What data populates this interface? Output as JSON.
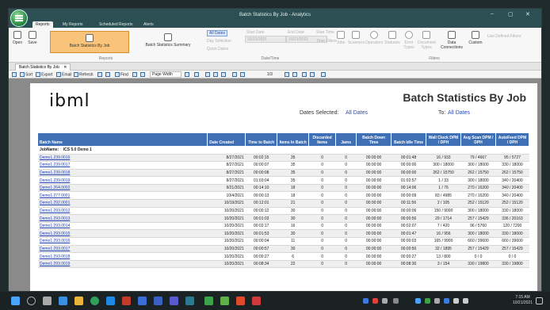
{
  "window": {
    "title": "Batch Statistics By Job - Analytics",
    "min": "–",
    "max": "▢",
    "close": "✕"
  },
  "ribbon_tabs": [
    "Reports",
    "My Reports",
    "Scheduled Reports",
    "Alerts"
  ],
  "ribbon": {
    "open": "Open",
    "save": "Save",
    "batch_stats_by_job": "Batch Statistics By Job",
    "batch_stats_summary": "Batch Statistics Summary",
    "reports_group": "Reports",
    "all_dates": "All Dates",
    "day_selection": "Day Selection",
    "start_date_label": "Start Date",
    "start_date": "10/21/2021",
    "end_date_label": "End Date",
    "end_date": "10/21/2021",
    "quick_dates": "Quick Dates",
    "date_time_group": "Date/Time",
    "start_time": "Start Time",
    "time_filters": "Time Filters",
    "jobs": "Jobs",
    "scanners": "Scanners",
    "operators": "Operators",
    "statuses": "Statuses",
    "error_types": "Error Types",
    "document_types": "Document Types",
    "data_connections": "Data Connections",
    "custom": "Custom",
    "use_defined_filters": "Use Defined Filters",
    "filters_group": "Filters"
  },
  "doc_tab": {
    "label": "Batch Statistics By Job",
    "close": "✕"
  },
  "toolbar": {
    "sort": "Sort",
    "export": "Export",
    "email": "Email",
    "refresh": "Refresh",
    "find": "Find",
    "zoom": "Page Width",
    "page": "1/3"
  },
  "report": {
    "logo": "ibml",
    "title": "Batch Statistics By Job",
    "dates_label": "Dates Selected:",
    "dates_value": "All Dates",
    "to_label": "To:",
    "to_value": "All Dates",
    "columns": [
      "Batch Name",
      "Date Created",
      "Time to Batch",
      "Items In Batch",
      "Discarded Items",
      "Jams",
      "Batch Down Time",
      "Batch Idle Time",
      "Wall Clock DPM / DPH",
      "Avg Scan DPM / DPH",
      "AutoFeed DPM / DPH"
    ],
    "job_label": "JobName:",
    "job_value": "ICS 5.0 Demo 1",
    "rows": [
      [
        "Demo1.239.0016",
        "8/27/2021",
        "00:02:15",
        "35",
        "0",
        "0",
        "00:00:00",
        "00:01:48",
        "16 / 933",
        "79 / 4667",
        "95 / 5727"
      ],
      [
        "Demo1.239.0017",
        "8/27/2021",
        "00:00:07",
        "35",
        "0",
        "0",
        "00:00:00",
        "00:00:00",
        "300 / 18000",
        "300 / 18000",
        "330 / 18000"
      ],
      [
        "Demo1.239.0018",
        "8/27/2021",
        "00:00:08",
        "35",
        "0",
        "0",
        "00:00:00",
        "00:00:00",
        "262 / 15750",
        "262 / 15750",
        "262 / 15750"
      ],
      [
        "Demo1.239.0019",
        "8/27/2021",
        "01:03:04",
        "35",
        "0",
        "0",
        "00:00:00",
        "01:02:57",
        "1 / 33",
        "300 / 18000",
        "340 / 20400"
      ],
      [
        "Demo1.264.0002",
        "9/21/2021",
        "00:14:10",
        "18",
        "0",
        "0",
        "00:00:00",
        "00:14:06",
        "1 / 76",
        "270 / 16200",
        "340 / 20400"
      ],
      [
        "Demo1.277.0001",
        "10/4/2021",
        "00:00:13",
        "18",
        "0",
        "0",
        "00:00:00",
        "00:00:09",
        "83 / 4985",
        "270 / 16200",
        "340 / 20400"
      ],
      [
        "Demo1.292.0001",
        "10/19/2021",
        "00:12:01",
        "21",
        "0",
        "0",
        "00:00:00",
        "00:11:56",
        "2 / 105",
        "252 / 15120",
        "252 / 15120"
      ],
      [
        "Demo1.293.0012",
        "10/20/2021",
        "00:00:12",
        "30",
        "0",
        "0",
        "00:00:00",
        "00:00:06",
        "150 / 9000",
        "300 / 18000",
        "330 / 18000"
      ],
      [
        "Demo1.293.0013",
        "10/20/2021",
        "00:01:03",
        "30",
        "0",
        "0",
        "00:00:00",
        "00:00:56",
        "29 / 1714",
        "257 / 15429",
        "336 / 20163"
      ],
      [
        "Demo1.293.0014",
        "10/20/2021",
        "00:02:17",
        "16",
        "0",
        "0",
        "00:00:00",
        "00:02:07",
        "7 / 420",
        "96 / 5760",
        "120 / 7200"
      ],
      [
        "Demo1.293.0015",
        "10/20/2021",
        "00:01:53",
        "30",
        "0",
        "0",
        "00:00:00",
        "00:01:47",
        "16 / 956",
        "300 / 18000",
        "330 / 18000"
      ],
      [
        "Demo1.293.0016",
        "10/20/2021",
        "00:00:04",
        "11",
        "0",
        "0",
        "00:00:00",
        "00:00:03",
        "165 / 9900",
        "660 / 39600",
        "660 / 39600"
      ],
      [
        "Demo1.293.0017",
        "10/20/2021",
        "00:00:57",
        "30",
        "0",
        "0",
        "00:00:00",
        "00:00:50",
        "32 / 1895",
        "257 / 15429",
        "257 / 15429"
      ],
      [
        "Demo1.293.0018",
        "10/20/2021",
        "00:00:27",
        "6",
        "0",
        "0",
        "00:00:00",
        "00:00:27",
        "13 / 800",
        "0 / 0",
        "0 / 0"
      ],
      [
        "Demo1.293.0019",
        "10/20/2021",
        "00:08:34",
        "22",
        "0",
        "0",
        "00:00:00",
        "00:08:30",
        "3 / 154",
        "330 / 19800",
        "330 / 19800"
      ]
    ]
  },
  "taskbar": {
    "time": "7:15 AM",
    "date": "10/21/2021"
  }
}
